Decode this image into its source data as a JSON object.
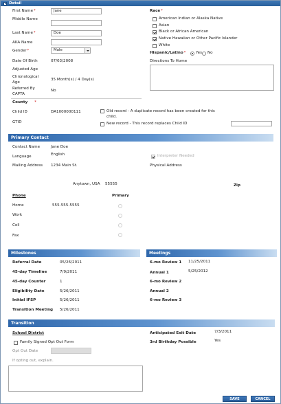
{
  "window": {
    "title": "Detail"
  },
  "detail": {
    "first_name_label": "First Name",
    "first_name_value": "Jane",
    "middle_name_label": "Middle Name",
    "middle_name_value": "",
    "last_name_label": "Last Name",
    "last_name_value": "Doe",
    "aka_name_label": "AKA Name",
    "aka_name_value": "",
    "gender_label": "Gender",
    "gender_value": "Male",
    "dob_label": "Date Of Birth",
    "dob_value": "07/03/2008",
    "adjusted_age_label": "Adjusted Age",
    "adjusted_age_value": "",
    "chrono_age_label": "Chronological Age",
    "chrono_age_value": "35 Month(s) / 4 Day(s)",
    "referred_by_label": "Referred By CAPTA",
    "referred_by_value": "No",
    "county_label": "County",
    "child_id_label": "Child ID",
    "child_id_value": "DA1000000111",
    "gtid_label": "GTID",
    "old_record_text": "Old record - A duplicate record has been created for this child.",
    "new_record_text": "New record - This record replaces Child ID",
    "new_record_input": "",
    "race_label": "Race",
    "race_options": [
      {
        "label": "American Indian or Alaska Native",
        "checked": false
      },
      {
        "label": "Asian",
        "checked": false
      },
      {
        "label": "Black or African American",
        "checked": true
      },
      {
        "label": "Native Hawaiian or Other Pacific Islander",
        "checked": true
      },
      {
        "label": "White",
        "checked": false
      }
    ],
    "hispanic_label": "Hispanic/Latino",
    "hispanic_yes": "Yes",
    "hispanic_no": "No",
    "hispanic_value": "Yes",
    "directions_label": "Directions To Home",
    "directions_value": ""
  },
  "primary_contact": {
    "header": "Primary Contact",
    "contact_name_label": "Contact Name",
    "contact_name_value": "Jane Doe",
    "language_label": "Language",
    "language_value": "English",
    "interpreter_label": "Interpreter Needed",
    "mailing_label": "Mailing Address",
    "mailing_value": "1234 Main St.",
    "physical_label": "Physical Address",
    "city_state": "Anytown, USA",
    "zip_value": "55555",
    "zip_label": "Zip",
    "phone_label": "Phone",
    "primary_label": "Primary",
    "phones": [
      {
        "type": "Home",
        "number": "555-555-5555"
      },
      {
        "type": "Work",
        "number": ""
      },
      {
        "type": "Cell",
        "number": ""
      },
      {
        "type": "Fax",
        "number": ""
      }
    ]
  },
  "milestones": {
    "header": "Milestones",
    "rows": [
      {
        "label": "Referral Date",
        "value": "05/26/2011"
      },
      {
        "label": "45-day Timeline",
        "value": "7/9/2011"
      },
      {
        "label": "45-day Counter",
        "value": "1"
      },
      {
        "label": "Eligibility Date",
        "value": "5/26/2011"
      },
      {
        "label": "Initial IFSP",
        "value": "5/26/2011"
      },
      {
        "label": "Transition Meeting",
        "value": "5/26/2011"
      }
    ]
  },
  "meetings": {
    "header": "Meetings",
    "rows": [
      {
        "label": "6-mo Review 1",
        "value": "11/25/2011"
      },
      {
        "label": "Annual 1",
        "value": "5/25/2012"
      },
      {
        "label": "6-mo Review 2",
        "value": ""
      },
      {
        "label": "Annual 2",
        "value": ""
      },
      {
        "label": "6-mo Review 3",
        "value": ""
      }
    ]
  },
  "transition": {
    "header": "Transition",
    "school_district_label": "School District",
    "family_signed_label": "Family Signed Opt Out Form",
    "opt_out_date_label": "Opt Out Date",
    "opt_out_explain_label": "If opting out, explain.",
    "anticipated_exit_label": "Anticipated Exit Date",
    "anticipated_exit_value": "7/3/2011",
    "third_birthday_label": "3rd Birthday Possible",
    "third_birthday_value": "Yes"
  },
  "buttons": {
    "save": "SAVE",
    "cancel": "CANCEL"
  }
}
